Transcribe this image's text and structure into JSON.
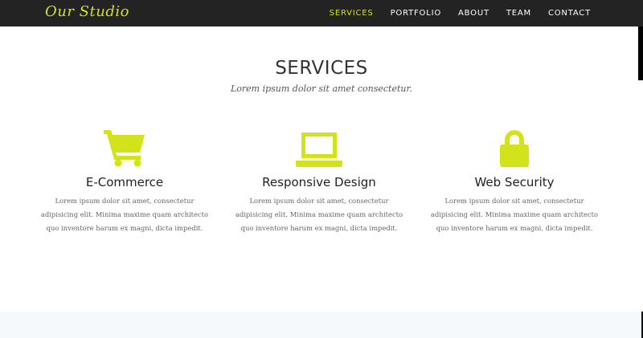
{
  "brand": {
    "name": "Our Studio"
  },
  "nav": {
    "items": [
      {
        "label": "SERVICES",
        "active": true
      },
      {
        "label": "PORTFOLIO",
        "active": false
      },
      {
        "label": "ABOUT",
        "active": false
      },
      {
        "label": "TEAM",
        "active": false
      },
      {
        "label": "CONTACT",
        "active": false
      }
    ]
  },
  "colors": {
    "accent": "#d2e21b",
    "navbar": "#232323",
    "band": "#f5f9fc"
  },
  "services": {
    "title": "SERVICES",
    "subtitle": "Lorem ipsum dolor sit amet consectetur.",
    "items": [
      {
        "icon": "shopping-cart-icon",
        "title": "E-Commerce",
        "description": "Lorem ipsum dolor sit amet, consectetur adipisicing elit. Minima maxime quam architecto quo inventore harum ex magni, dicta impedit."
      },
      {
        "icon": "laptop-icon",
        "title": "Responsive Design",
        "description": "Lorem ipsum dolor sit amet, consectetur adipisicing elit. Minima maxime quam architecto quo inventore harum ex magni, dicta impedit."
      },
      {
        "icon": "lock-icon",
        "title": "Web Security",
        "description": "Lorem ipsum dolor sit amet, consectetur adipisicing elit. Minima maxime quam architecto quo inventore harum ex magni, dicta impedit."
      }
    ]
  }
}
